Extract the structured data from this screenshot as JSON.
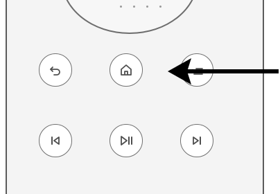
{
  "remote": {
    "top_row": [
      {
        "name": "back-button",
        "icon": "back-arrow-icon"
      },
      {
        "name": "home-button",
        "icon": "home-icon"
      },
      {
        "name": "menu-button",
        "icon": "menu-list-icon"
      }
    ],
    "bottom_row": [
      {
        "name": "previous-button",
        "icon": "skip-previous-icon"
      },
      {
        "name": "play-pause-button",
        "icon": "play-pause-icon"
      },
      {
        "name": "next-button",
        "icon": "skip-next-icon"
      }
    ]
  },
  "annotation": {
    "icon": "pointer-arrow-icon",
    "points_to": "home-button"
  },
  "colors": {
    "outline": "#6f6f6f",
    "arrow": "#000000",
    "body": "#f4f4f4"
  }
}
